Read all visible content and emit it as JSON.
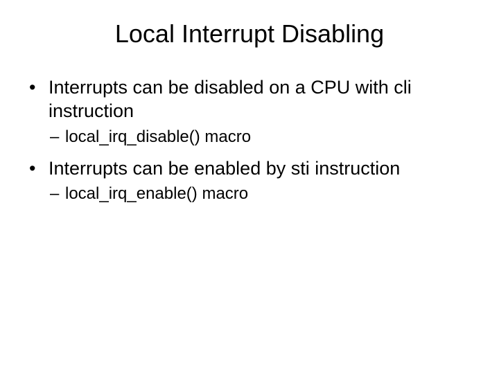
{
  "slide": {
    "title": "Local Interrupt Disabling",
    "bullets": [
      {
        "text": "Interrupts can be disabled on a CPU with cli instruction",
        "sub": [
          {
            "text": "local_irq_disable() macro"
          }
        ]
      },
      {
        "text": "Interrupts can be enabled by sti instruction",
        "sub": [
          {
            "text": "local_irq_enable() macro"
          }
        ]
      }
    ]
  },
  "markers": {
    "level1": "•",
    "level2": "–"
  }
}
